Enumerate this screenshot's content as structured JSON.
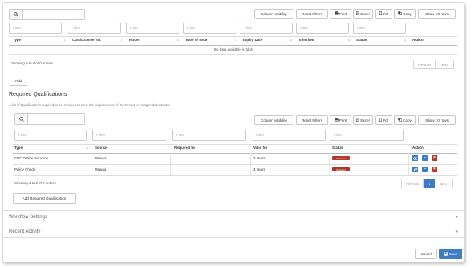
{
  "colors": {
    "accent": "#3c7dc4",
    "danger": "#b5342c",
    "badge": "#b5342c"
  },
  "table1": {
    "search_placeholder": "",
    "buttons": [
      "Column visibility",
      "Reset Filters",
      "Print",
      "Excel",
      "Pdf",
      "Copy",
      "Show 10 rows"
    ],
    "filters": [
      "Filter",
      "Filter",
      "Filter",
      "Filter",
      "Filter",
      "Filter",
      "Filter"
    ],
    "headers": [
      "Type",
      "Card/License no.",
      "Issuer",
      "Date of Issue",
      "Expiry Date",
      "Inherited",
      "Status",
      "Action"
    ],
    "empty_text": "No data available in table",
    "info": "Showing 0 to 0 of 0 entries",
    "pager": {
      "previous": "Previous",
      "next": "Next"
    },
    "add_label": "Add"
  },
  "required": {
    "title": "Required Qualifications",
    "description": "A list of Qualifications required to be provided to meet the requirements of the Tenant or Assigned Contracts.",
    "buttons": [
      "Column visibility",
      "Reset Filters",
      "Print",
      "Excel",
      "Pdf",
      "Copy",
      "Show 10 rows"
    ],
    "filters": [
      "Filter",
      "Filter",
      "Filter",
      "Filter",
      "Filter"
    ],
    "headers": [
      "Type",
      "Source",
      "Required for",
      "Valid for",
      "Status",
      "Action"
    ],
    "rows": [
      {
        "type": "CBC Online Induction",
        "source": "Manual",
        "required_for": "",
        "valid_for": "3 Years",
        "status": "Required"
      },
      {
        "type": "Police Check",
        "source": "Manual",
        "required_for": "",
        "valid_for": "3 Years",
        "status": "Required"
      }
    ],
    "info": "Showing 1 to 2 of 2 entries",
    "pager": {
      "previous": "Previous",
      "page": "1",
      "next": "Next"
    },
    "add_label": "Add Required Qualification"
  },
  "accordions": [
    "Workflow Settings",
    "Recent Activity"
  ],
  "footer": {
    "cancel": "Cancel",
    "save": "Save"
  },
  "icons": {
    "search": "search-icon",
    "print": "print-icon",
    "excel": "excel-icon",
    "pdf": "pdf-icon",
    "copy": "copy-icon",
    "view": "eye-icon",
    "add": "plus-icon",
    "delete": "close-icon",
    "edit": "share-icon",
    "save": "save-icon"
  }
}
